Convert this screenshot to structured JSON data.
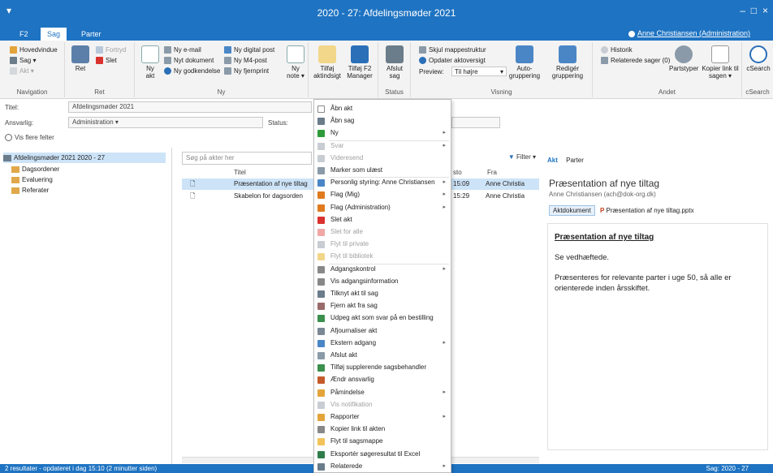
{
  "window": {
    "title": "2020 - 27: Afdelingsmøder 2021",
    "quick_access": "▾",
    "min_icon": "minimize-icon",
    "close_icon": "close-icon",
    "min_glyph": "–",
    "max_glyph": "□",
    "close_glyph": "×"
  },
  "tabs": [
    "F2",
    "Sag",
    "Parter"
  ],
  "user_link": "Anne Christiansen (Administration)",
  "ribbon": {
    "navigation": {
      "label": "Navigation",
      "items": [
        "Hovedvindue",
        "Sag ▾",
        "Akt ▾"
      ]
    },
    "ret": {
      "label": "Ret",
      "ret_label": "Ret",
      "fortryd_label": "Fortryd",
      "slet_label": "Slet"
    },
    "ny": {
      "label": "Ny",
      "ny_akt_label": "Ny akt",
      "ny_note_label": "Ny note ▾",
      "items": [
        "Ny e-mail",
        "Nyt dokument",
        "Ny godkendelse",
        "Ny digital post",
        "Ny M4-post",
        "Ny fjernprint"
      ]
    },
    "tilfoej": {
      "aktindsigt_label": "Tilføj aktindsigt",
      "f2manager_label": "Tilføj F2 Manager"
    },
    "status": {
      "label": "Status",
      "afslut_label": "Afslut sag"
    },
    "visning": {
      "label": "Visning",
      "skjul_label": "Skjul mappestruktur",
      "opdater_label": "Opdater aktoversigt",
      "preview_label": "Preview:",
      "preview_value": "Til højre",
      "autogruppering_label": "Auto-gruppering",
      "rediger_label": "Redigér gruppering"
    },
    "andet": {
      "label": "Andet",
      "historik_label": "Historik",
      "relaterede_label": "Relaterede sager (0)",
      "partstyper_label": "Partstyper",
      "kopier_label": "Kopier link til sagen ▾"
    },
    "search_label": "cSearch",
    "search_group_label": "cSearch"
  },
  "fields": {
    "titel_label": "Titel:",
    "titel_value": "Afdelingsmøder 2021",
    "ansvarlig_label": "Ansvarlig:",
    "ansvarlig_value": "Administration ▾",
    "status_label": "Status:",
    "more_label": "Vis flere felter"
  },
  "tree": {
    "root": "Afdelingsmøder 2021 2020 - 27",
    "children": [
      "Dagsordener",
      "Evaluering",
      "Referater"
    ]
  },
  "list": {
    "search_placeholder": "Søg på akter her",
    "filter_label": "Filter ▾",
    "columns": [
      "Titel",
      "sto",
      "Fra"
    ],
    "rows": [
      {
        "title": "Præsentation af nye tiltag",
        "time": "15:09",
        "from": "Anne Christia"
      },
      {
        "title": "Skabelon for dagsorden",
        "time": "15:29",
        "from": "Anne Christia"
      }
    ]
  },
  "context_menu": {
    "items": [
      {
        "label": "Åbn akt",
        "submenu": false,
        "disabled": false,
        "icon": "open-icon",
        "color": "#ffffff"
      },
      {
        "label": "Åbn sag",
        "submenu": false,
        "disabled": false,
        "icon": "case-icon",
        "color": "#6b7c8a"
      },
      {
        "label": "Ny",
        "submenu": true,
        "disabled": false,
        "icon": "plus-icon",
        "color": "#2e9b3b"
      },
      {
        "label": "Svar",
        "submenu": true,
        "disabled": true,
        "icon": "reply-icon",
        "color": "#c8ccd3"
      },
      {
        "label": "Videresend",
        "submenu": false,
        "disabled": true,
        "icon": "forward-icon",
        "color": "#c8ccd3"
      },
      {
        "label": "Marker som ulæst",
        "submenu": false,
        "disabled": false,
        "icon": "envelope-icon",
        "color": "#8a9aa8"
      },
      {
        "label": "Personlig styring: Anne Christiansen",
        "submenu": true,
        "disabled": false,
        "icon": "personal-icon",
        "color": "#4a86c6"
      },
      {
        "label": "Flag (Mig)",
        "submenu": true,
        "disabled": false,
        "icon": "flag-icon",
        "color": "#e07a1f"
      },
      {
        "label": "Flag (Administration)",
        "submenu": true,
        "disabled": false,
        "icon": "flag-icon",
        "color": "#e07a1f"
      },
      {
        "label": "Slet akt",
        "submenu": false,
        "disabled": false,
        "icon": "delete-icon",
        "color": "#d9322e"
      },
      {
        "label": "Slet for alle",
        "submenu": false,
        "disabled": true,
        "icon": "delete-all-icon",
        "color": "#f0a8a6"
      },
      {
        "label": "Flyt til private",
        "submenu": false,
        "disabled": true,
        "icon": "move-private-icon",
        "color": "#c8ccd3"
      },
      {
        "label": "Flyt til bibliotek",
        "submenu": false,
        "disabled": true,
        "icon": "library-icon",
        "color": "#f2d78a"
      },
      {
        "label": "Adgangskontrol",
        "submenu": true,
        "disabled": false,
        "icon": "key-icon",
        "color": "#888888"
      },
      {
        "label": "Vis adgangsinformation",
        "submenu": false,
        "disabled": false,
        "icon": "key-icon",
        "color": "#888888"
      },
      {
        "label": "Tilknyt akt til sag",
        "submenu": false,
        "disabled": false,
        "icon": "attach-icon",
        "color": "#6b7c8a"
      },
      {
        "label": "Fjern akt fra sag",
        "submenu": false,
        "disabled": false,
        "icon": "detach-icon",
        "color": "#9a6b6b"
      },
      {
        "label": "Udpeg akt som svar på en bestilling",
        "submenu": false,
        "disabled": false,
        "icon": "order-icon",
        "color": "#3b8f4d"
      },
      {
        "label": "Afjournaliser akt",
        "submenu": false,
        "disabled": false,
        "icon": "unjournal-icon",
        "color": "#7a8794"
      },
      {
        "label": "Ekstern adgang",
        "submenu": true,
        "disabled": false,
        "icon": "external-icon",
        "color": "#4a86c6"
      },
      {
        "label": "Afslut akt",
        "submenu": false,
        "disabled": false,
        "icon": "finish-icon",
        "color": "#8a9aa8"
      },
      {
        "label": "Tilføj supplerende sagsbehandler",
        "submenu": false,
        "disabled": false,
        "icon": "add-user-icon",
        "color": "#3b8f4d"
      },
      {
        "label": "Ændr ansvarlig",
        "submenu": false,
        "disabled": false,
        "icon": "responsible-icon",
        "color": "#c45a2a"
      },
      {
        "label": "Påmindelse",
        "submenu": true,
        "disabled": false,
        "icon": "reminder-icon",
        "color": "#e3a43a"
      },
      {
        "label": "Vis notifikation",
        "submenu": false,
        "disabled": true,
        "icon": "info-icon",
        "color": "#c8ccd3"
      },
      {
        "label": "Rapporter",
        "submenu": true,
        "disabled": false,
        "icon": "report-icon",
        "color": "#e3a43a"
      },
      {
        "label": "Kopier link til akten",
        "submenu": false,
        "disabled": false,
        "icon": "link-icon",
        "color": "#888888"
      },
      {
        "label": "Flyt til sagsmappe",
        "submenu": false,
        "disabled": false,
        "icon": "folder-icon",
        "color": "#f2c35a"
      },
      {
        "label": "Eksportér søgeresultat til Excel",
        "submenu": false,
        "disabled": false,
        "icon": "excel-icon",
        "color": "#2f7d4a"
      },
      {
        "label": "Relaterede",
        "submenu": true,
        "disabled": false,
        "icon": "related-icon",
        "color": "#6b7c8a"
      }
    ]
  },
  "preview": {
    "tabs": [
      "Akt",
      "Parter"
    ],
    "title": "Præsentation af nye tiltag",
    "sender": "Anne Christiansen (ach@dok-org.dk)",
    "akt_label": "Aktdokument",
    "file_name": "Præsentation af nye tiltag.pptx",
    "body_heading": "Præsentation af nye tiltag",
    "body_line1": "Se vedhæftede.",
    "body_line2": "Præsenteres for relevante parter i uge 50, så alle er orienterede inden årsskiftet."
  },
  "statusbar": {
    "left": "2 resultater - opdateret i dag 15:10 (2 minutter siden)",
    "right": "Sag: 2020 - 27"
  },
  "colors": {
    "accent": "#1e73c2",
    "selection": "#cde3f7"
  }
}
